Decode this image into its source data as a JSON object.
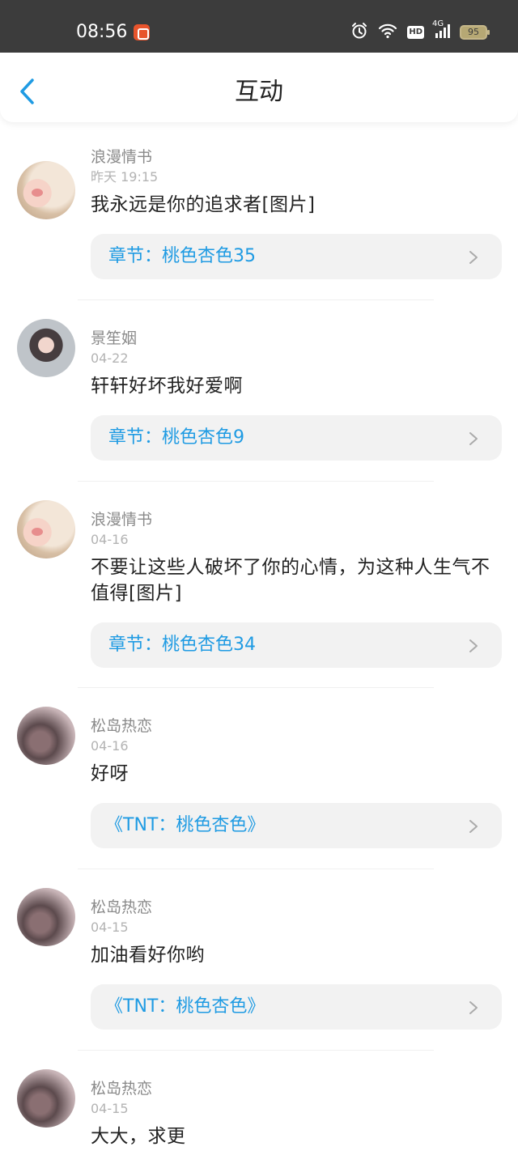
{
  "status_bar": {
    "time": "08:56",
    "hd": "HD",
    "network": "4G",
    "battery": "95"
  },
  "header": {
    "title": "互动"
  },
  "items": [
    {
      "name": "浪漫情书",
      "time": "昨天 19:15",
      "content": "我永远是你的追求者[图片]",
      "link": "章节：桃色杏色35"
    },
    {
      "name": "景笙姻",
      "time": "04-22",
      "content": "轩轩好坏我好爱啊",
      "link": "章节：桃色杏色9"
    },
    {
      "name": "浪漫情书",
      "time": "04-16",
      "content": "不要让这些人破坏了你的心情，为这种人生气不值得[图片]",
      "link": "章节：桃色杏色34"
    },
    {
      "name": "松岛热恋",
      "time": "04-16",
      "content": "好呀",
      "link": "《TNT：桃色杏色》"
    },
    {
      "name": "松岛热恋",
      "time": "04-15",
      "content": "加油看好你哟",
      "link": "《TNT：桃色杏色》"
    },
    {
      "name": "松岛热恋",
      "time": "04-15",
      "content": "大大，求更"
    }
  ],
  "colors": {
    "accent": "#1f9be3",
    "status_bar_bg": "#3c3c3c",
    "card_bg": "#f2f2f2"
  },
  "icons": [
    "back-chevron-icon",
    "alarm-icon",
    "wifi-icon",
    "signal-icon",
    "battery-icon",
    "chevron-right-icon"
  ]
}
